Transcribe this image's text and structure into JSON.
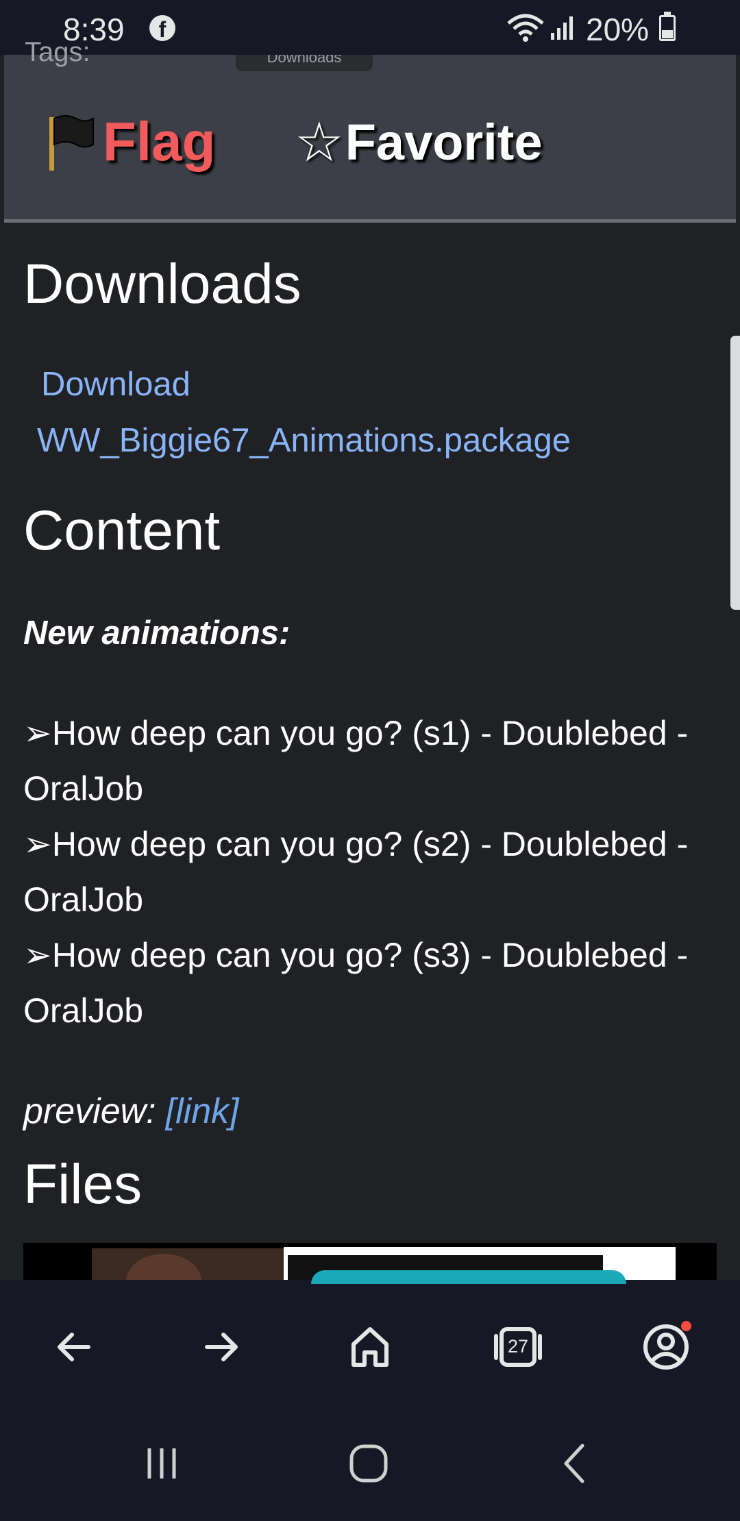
{
  "status_bar": {
    "time": "8:39",
    "battery_percent": "20%",
    "icons": [
      "facebook-icon",
      "wifi-icon",
      "signal-icon",
      "battery-icon"
    ]
  },
  "action_panel": {
    "tags_fragment": "Tags:",
    "tooltip_fragment": "Downloads",
    "flag_label": "Flag",
    "favorite_star": "☆",
    "favorite_label": "Favorite"
  },
  "downloads": {
    "heading": "Downloads",
    "link_line1": "Download",
    "link_line2": "WW_Biggie67_Animations.package"
  },
  "content": {
    "heading": "Content",
    "subheading": "New animations:",
    "items": [
      "➢How deep can you go? (s1) - Doublebed - OralJob",
      "➢How deep can you go? (s2) - Doublebed - OralJob",
      "➢How deep can you go? (s3) - Doublebed - OralJob"
    ],
    "preview_label": "preview:",
    "preview_link": "[link]"
  },
  "files": {
    "heading": "Files"
  },
  "browser_toolbar": {
    "tabs_count": "27",
    "buttons": [
      "back-icon",
      "forward-icon",
      "home-icon",
      "tabs-icon",
      "account-icon"
    ]
  },
  "colors": {
    "background": "#202124",
    "panel": "#3c3f48",
    "link": "#8ab4f8",
    "flag": "#f25b5b",
    "toolbar": "#161925"
  }
}
